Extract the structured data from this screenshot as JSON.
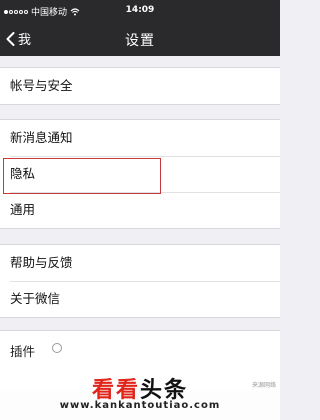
{
  "status_bar": {
    "carrier": "中国移动",
    "time": "14:09"
  },
  "nav": {
    "back_label": "我",
    "title": "设置"
  },
  "groups": [
    {
      "items": [
        {
          "label": "帐号与安全"
        }
      ]
    },
    {
      "items": [
        {
          "label": "新消息通知"
        },
        {
          "label": "隐私"
        },
        {
          "label": "通用"
        }
      ]
    },
    {
      "items": [
        {
          "label": "帮助与反馈"
        },
        {
          "label": "关于微信"
        }
      ]
    }
  ],
  "partial_item": {
    "label": "插件"
  },
  "highlight": {
    "target": "隐私",
    "color": "#c83a3a"
  },
  "watermark": {
    "part1": "看看",
    "part2": "头条",
    "url": "www.kankantoutiao.com",
    "corner_text": "来源网络"
  },
  "colors": {
    "nav_bg": "#2a2a2c",
    "page_bg": "#efeff4",
    "accent_red": "#e0251b"
  }
}
